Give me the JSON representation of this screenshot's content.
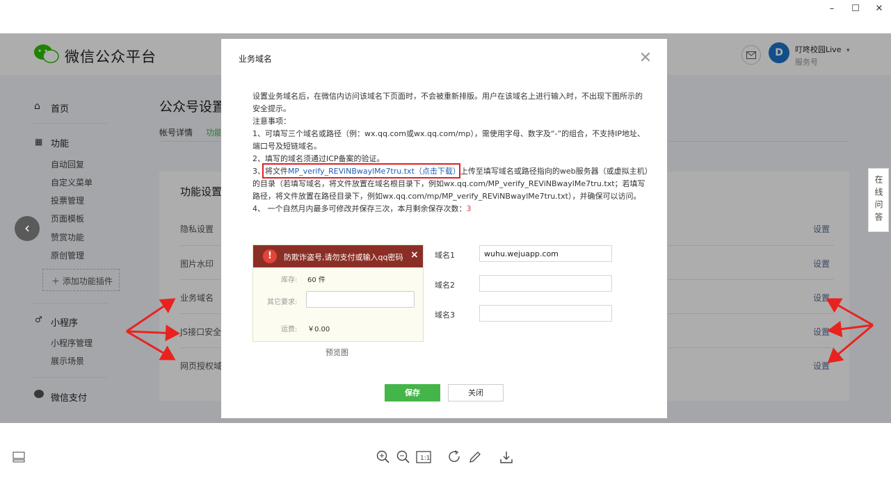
{
  "window_controls": {
    "minimize": "–",
    "maximize": "☐",
    "close": "✕"
  },
  "header": {
    "logo_text": "微信公众平台",
    "user_name": "叮咚校园Live",
    "user_role": "服务号"
  },
  "sidebar": {
    "home": "首页",
    "features": "功能",
    "feature_items": [
      "自动回复",
      "自定义菜单",
      "投票管理",
      "页面模板",
      "赞赏功能",
      "原创管理"
    ],
    "add_plugin": "添加功能插件",
    "miniprogram": "小程序",
    "miniprogram_items": [
      "小程序管理",
      "展示场景"
    ],
    "wechat_pay": "微信支付"
  },
  "main": {
    "page_title": "公众号设置",
    "tabs": [
      "帐号详情",
      "功能"
    ],
    "section_title": "功能设置",
    "rows": [
      {
        "label": "隐私设置",
        "action": "设置"
      },
      {
        "label": "图片水印",
        "action": "设置"
      },
      {
        "label": "业务域名",
        "action": "设置"
      },
      {
        "label": "JS接口安全",
        "action": "设置"
      },
      {
        "label": "网页授权域",
        "action": "设置"
      }
    ]
  },
  "side_tab": "在线问答",
  "dialog": {
    "title": "业务域名",
    "intro": "设置业务域名后，在微信内访问该域名下页面时，不会被重新排版。用户在该域名上进行输入时，不出现下图所示的安全提示。",
    "notes_heading": "注意事项：",
    "note1": "1、可填写三个域名或路径（例：wx.qq.com或wx.qq.com/mp），需使用字母、数字及“-”的组合，不支持IP地址、端口号及短链域名。",
    "note2": "2、填写的域名须通过ICP备案的验证。",
    "note3_prefix": "3、",
    "note3_file_label": "将文件",
    "note3_file": "MP_verify_REViNBwaylMe7tru.txt（点击下载）",
    "note3_rest": "上传至填写域名或路径指向的web服务器（或虚拟主机）的目录（若填写域名，将文件放置在域名根目录下，例如wx.qq.com/MP_verify_REViNBwaylMe7tru.txt；若填写路径，将文件放置在路径目录下，例如wx.qq.com/mp/MP_verify_REViNBwaylMe7tru.txt），并确保可以访问。",
    "note4": "4、 一个自然月内最多可修改并保存三次，本月剩余保存次数：",
    "note4_count": "3",
    "preview": {
      "warning": "防欺诈盗号,请勿支付或输入qq密码",
      "stock_label": "库存:",
      "stock_value": "60 件",
      "other_label": "其它要求:",
      "freight_label": "运费:",
      "freight_value": "￥0.00",
      "caption": "预览图"
    },
    "domains": [
      {
        "label": "域名1",
        "value": "wuhu.wejuapp.com"
      },
      {
        "label": "域名2",
        "value": ""
      },
      {
        "label": "域名3",
        "value": ""
      }
    ],
    "save": "保存",
    "close": "关闭"
  },
  "colors": {
    "accent": "#44b549",
    "link": "#1d5fb6",
    "highlight": "#e02020",
    "arrow": "#e8231f"
  }
}
